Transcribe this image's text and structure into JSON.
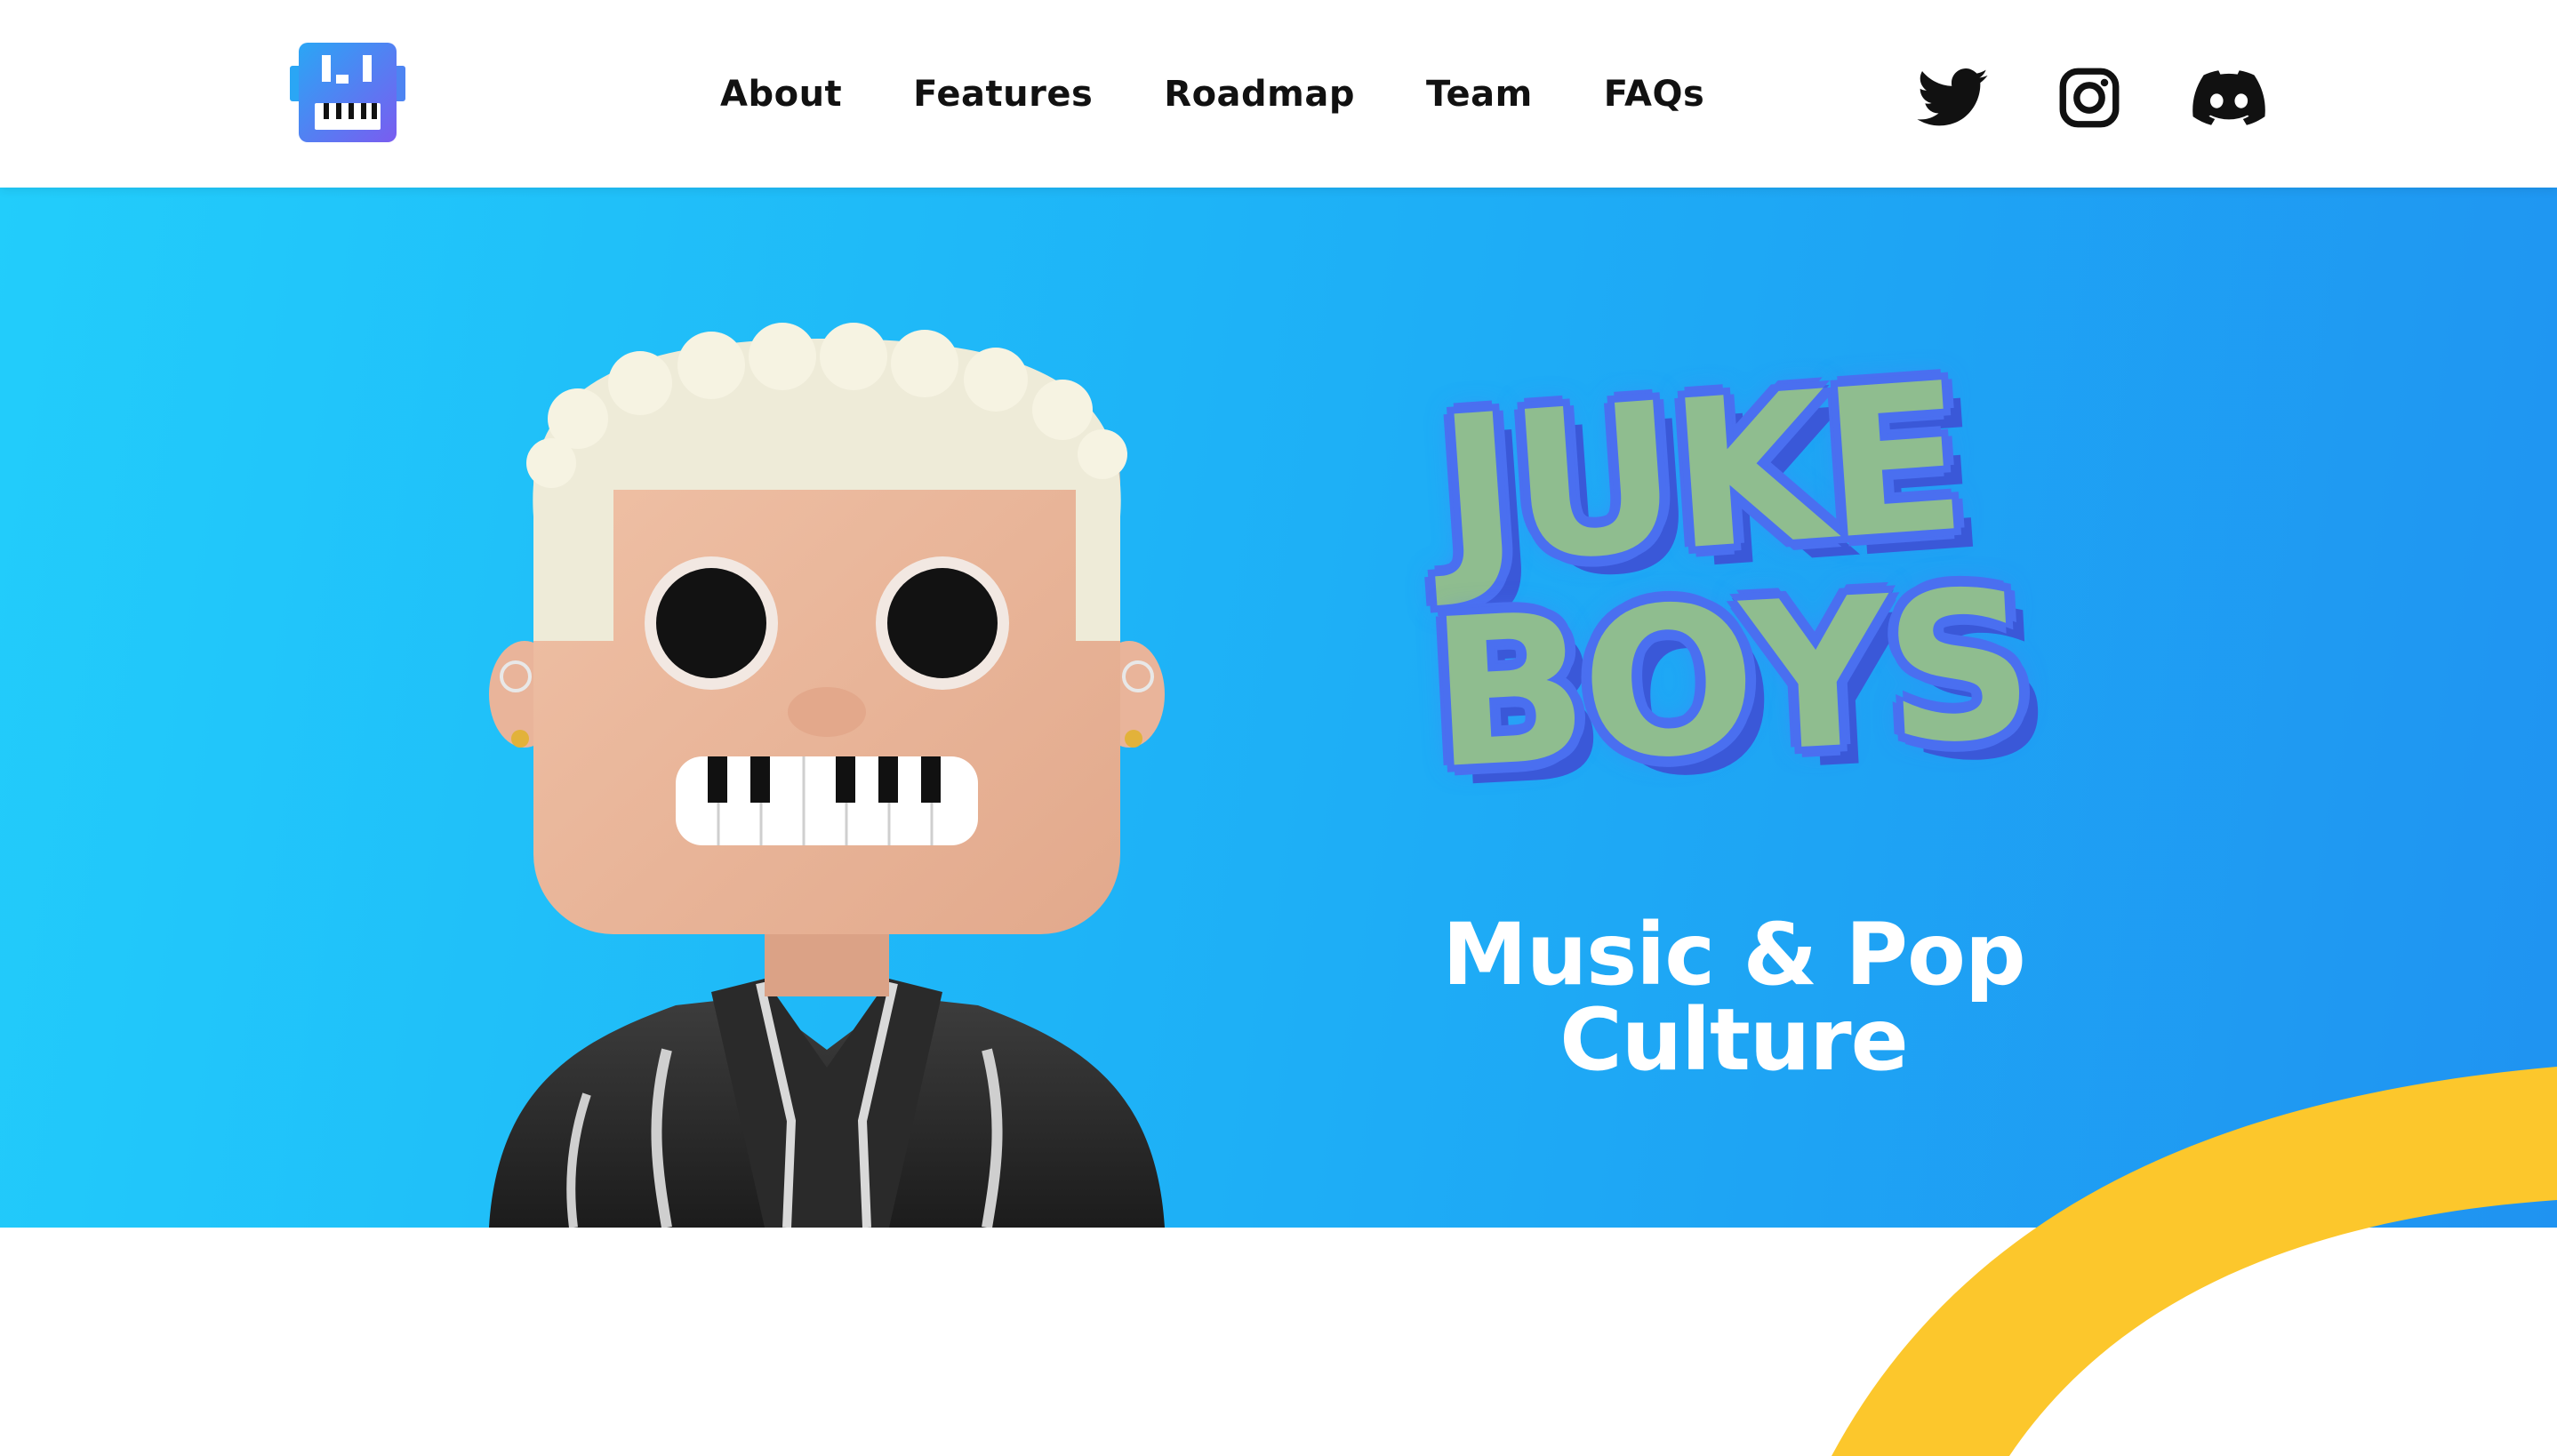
{
  "nav": {
    "logo": "juke-boys-logo",
    "links": [
      "About",
      "Features",
      "Roadmap",
      "Team",
      "FAQs"
    ],
    "social": [
      "twitter-icon",
      "instagram-icon",
      "discord-icon"
    ]
  },
  "hero": {
    "title_line1": "JUKE",
    "title_line2": "BOYS",
    "subtitle_line1": "Music & Pop",
    "subtitle_line2": "Culture",
    "figure": "juke-boy-character"
  },
  "colors": {
    "hero_gradient_start": "#22cdfb",
    "hero_gradient_end": "#1f93f1",
    "title_fill": "#8fbd8f",
    "title_outline": "#4a6ff0",
    "arc": "#fcc72c"
  }
}
